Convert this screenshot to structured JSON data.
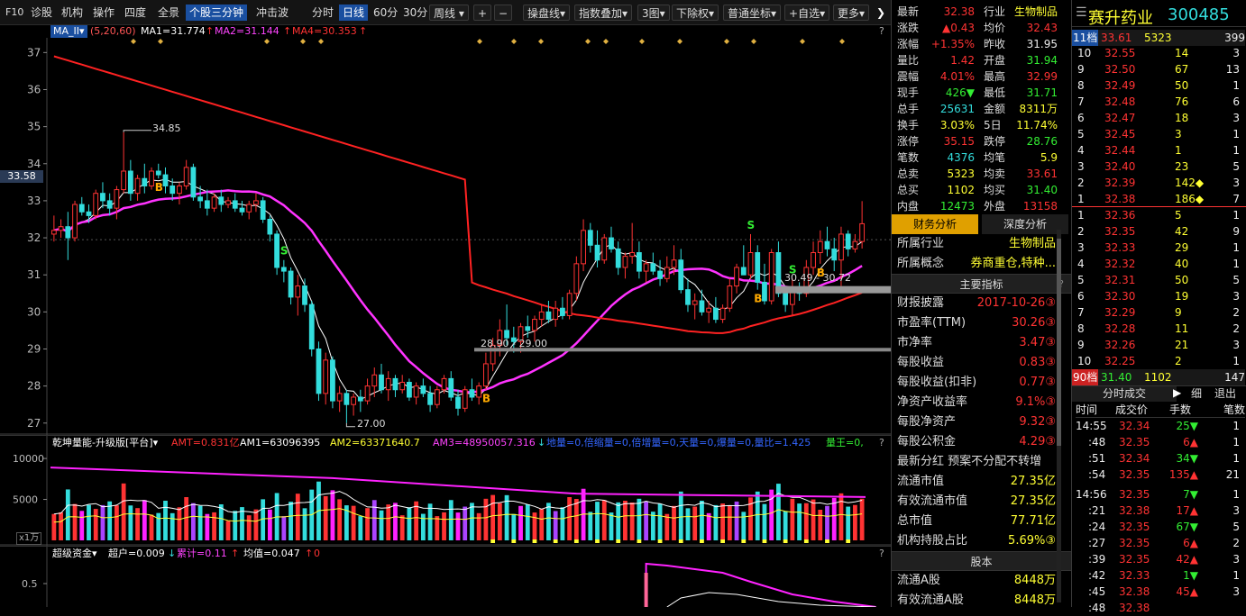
{
  "toolbar": {
    "items": [
      "F10",
      "诊股",
      "机构",
      "操作",
      "四度",
      "全景",
      "个股三分钟",
      "冲击波",
      "分时",
      "日线",
      "60分",
      "30分",
      "周线",
      "+",
      "−",
      "操盘线",
      "指数叠加",
      "3图",
      "下除权",
      "普通坐标",
      "自选",
      "更多"
    ],
    "active": [
      "个股三分钟",
      "日线"
    ]
  },
  "main_legend": {
    "name": "MA_II",
    "params": "(5,20,60)",
    "ma1": "MA1=31.774",
    "ma2": "MA2=31.144",
    "ma4": "MA4=30.353"
  },
  "price_tag": "33.58",
  "annotations": {
    "high": "34.85",
    "low": "27.00",
    "range1": "28.90 - 29.00",
    "range2": "30.49 - 30.72"
  },
  "vol_legend": {
    "name": "乾坤量能-升级版[平台]",
    "amt": "AMT=0.831亿",
    "am1": "AM1=63096395",
    "am2": "AM2=63371640.7",
    "am3": "AM3=48950057.316",
    "rest": "地量=0,倍缩量=0,倍增量=0,天量=0,爆量=0,量比=1.425",
    "wang": "量王=0,",
    "unit": "x1万"
  },
  "fund_legend": {
    "name": "超级资金",
    "chao": "超户=0.009",
    "lei": "累计=0.11",
    "jun": "均值=0.047",
    "tail": "0"
  },
  "axes": {
    "price": [
      "37",
      "36",
      "35",
      "34",
      "33",
      "32",
      "31",
      "30",
      "29",
      "28",
      "27"
    ],
    "volume": [
      "10000",
      "5000"
    ],
    "fund": [
      "0.5"
    ]
  },
  "stats": [
    [
      "最新",
      "32.38",
      "行业",
      "生物制品"
    ],
    [
      "涨跌",
      "▲0.43",
      "均价",
      "32.43"
    ],
    [
      "涨幅",
      "+1.35%",
      "昨收",
      "31.95"
    ],
    [
      "量比",
      "1.42",
      "开盘",
      "31.94"
    ],
    [
      "震幅",
      "4.01%",
      "最高",
      "32.99"
    ],
    [
      "现手",
      "426▼",
      "最低",
      "31.71"
    ],
    [
      "总手",
      "25631",
      "金额",
      "8311万"
    ],
    [
      "换手",
      "3.03%",
      "5日",
      "11.74%"
    ],
    [
      "涨停",
      "35.15",
      "跌停",
      "28.76"
    ],
    [
      "笔数",
      "4376",
      "均笔",
      "5.9"
    ],
    [
      "总卖",
      "5323",
      "均卖",
      "33.61"
    ],
    [
      "总买",
      "1102",
      "均买",
      "31.40"
    ],
    [
      "内盘",
      "12473",
      "外盘",
      "13158"
    ]
  ],
  "tabs": {
    "finance": "财务分析",
    "depth": "深度分析"
  },
  "industry": {
    "label": "所属行业",
    "value": "生物制品"
  },
  "concept": {
    "label": "所属概念",
    "value": "券商重仓,特种..."
  },
  "indicators_title": "主要指标",
  "fin": [
    [
      "财报披露",
      "2017-10-26③"
    ],
    [
      "市盈率(TTM)",
      "30.26③"
    ],
    [
      "市净率",
      "3.47③"
    ],
    [
      "每股收益",
      "0.83③"
    ],
    [
      "每股收益(扣非)",
      "0.77③"
    ],
    [
      "净资产收益率",
      "9.1%③"
    ],
    [
      "每股净资产",
      "9.32③"
    ],
    [
      "每股公积金",
      "4.29③"
    ]
  ],
  "dividend": "最新分红  预案不分配不转增",
  "fin2": [
    [
      "流通市值",
      "27.35亿"
    ],
    [
      "有效流通市值",
      "27.35亿"
    ],
    [
      "总市值",
      "77.71亿"
    ],
    [
      "机构持股占比",
      "5.69%③"
    ]
  ],
  "equity_title": "股本",
  "equity": [
    [
      "流通A股",
      "8448万"
    ],
    [
      "有效流通A股",
      "8448万"
    ]
  ],
  "stock": {
    "name": "赛升药业",
    "code": "300485"
  },
  "top_row": {
    "label": "11档",
    "price": "33.61",
    "vol": "5323",
    "count": "399"
  },
  "asks": [
    [
      "10",
      "32.55",
      "14",
      "3"
    ],
    [
      "9",
      "32.50",
      "67",
      "13"
    ],
    [
      "8",
      "32.49",
      "50",
      "1"
    ],
    [
      "7",
      "32.48",
      "76",
      "6"
    ],
    [
      "6",
      "32.47",
      "18",
      "3"
    ],
    [
      "5",
      "32.45",
      "3",
      "1"
    ],
    [
      "4",
      "32.44",
      "1",
      "1"
    ],
    [
      "3",
      "32.40",
      "23",
      "5"
    ],
    [
      "2",
      "32.39",
      "142◆",
      "3"
    ],
    [
      "1",
      "32.38",
      "186◆",
      "7"
    ]
  ],
  "bids": [
    [
      "1",
      "32.36",
      "5",
      "1"
    ],
    [
      "2",
      "32.35",
      "42",
      "9"
    ],
    [
      "3",
      "32.33",
      "29",
      "1"
    ],
    [
      "4",
      "32.32",
      "40",
      "1"
    ],
    [
      "5",
      "32.31",
      "50",
      "5"
    ],
    [
      "6",
      "32.30",
      "19",
      "3"
    ],
    [
      "7",
      "32.29",
      "9",
      "2"
    ],
    [
      "8",
      "32.28",
      "11",
      "2"
    ],
    [
      "9",
      "32.26",
      "21",
      "3"
    ],
    [
      "10",
      "32.25",
      "2",
      "1"
    ]
  ],
  "bottom_row": {
    "label": "90档",
    "price": "31.40",
    "vol": "1102",
    "count": "147"
  },
  "trades_tabs": {
    "main": "分时成交",
    "fine": "细",
    "exit": "退出"
  },
  "trades_header": [
    "时间",
    "成交价",
    "手数",
    "笔数"
  ],
  "trades": [
    [
      "14:55",
      "32.34",
      "25▼",
      "1"
    ],
    [
      ":48",
      "32.35",
      "6▲",
      "1"
    ],
    [
      ":51",
      "32.34",
      "34▼",
      "1"
    ],
    [
      ":54",
      "32.35",
      "135▲",
      "21"
    ],
    [
      "14:56",
      "32.35",
      "7▼",
      "1"
    ],
    [
      ":21",
      "32.38",
      "17▲",
      "3"
    ],
    [
      ":24",
      "32.35",
      "67▼",
      "5"
    ],
    [
      ":27",
      "32.35",
      "6▲",
      "2"
    ],
    [
      ":39",
      "32.35",
      "42▲",
      "3"
    ],
    [
      ":42",
      "32.33",
      "1▼",
      "1"
    ],
    [
      ":45",
      "32.38",
      "45▲",
      "3"
    ],
    [
      ":48",
      "32.38",
      "",
      ""
    ]
  ],
  "colors": {
    "up": "#ff3333",
    "down": "#33dddd",
    "ma1": "#ffffff",
    "ma2": "#ff33ff",
    "ma4": "#ff2222",
    "accent": "#1a4fa0"
  },
  "chart_data": {
    "type": "candlestick",
    "ohlc": [
      [
        32.1,
        32.6,
        31.9,
        32.2
      ],
      [
        32.2,
        32.5,
        32.0,
        32.3
      ],
      [
        32.3,
        32.7,
        31.4,
        32.0
      ],
      [
        32.0,
        33.0,
        31.9,
        32.9
      ],
      [
        32.9,
        33.1,
        32.6,
        32.7
      ],
      [
        32.7,
        32.9,
        32.4,
        32.6
      ],
      [
        32.6,
        33.3,
        32.5,
        33.2
      ],
      [
        33.2,
        33.5,
        32.8,
        33.0
      ],
      [
        33.0,
        33.2,
        32.6,
        32.8
      ],
      [
        32.8,
        33.4,
        32.5,
        33.3
      ],
      [
        33.3,
        34.85,
        33.2,
        33.8
      ],
      [
        33.8,
        34.1,
        33.0,
        33.2
      ],
      [
        33.2,
        33.7,
        33.0,
        33.6
      ],
      [
        33.6,
        34.0,
        33.2,
        33.4
      ],
      [
        33.4,
        33.9,
        33.3,
        33.8
      ],
      [
        33.8,
        34.0,
        33.6,
        33.7
      ],
      [
        33.7,
        33.9,
        33.2,
        33.4
      ],
      [
        33.4,
        33.6,
        33.0,
        33.2
      ],
      [
        33.2,
        33.5,
        32.9,
        33.4
      ],
      [
        33.4,
        34.1,
        33.3,
        33.9
      ],
      [
        33.9,
        34.0,
        33.0,
        33.1
      ],
      [
        33.1,
        33.4,
        32.8,
        33.0
      ],
      [
        33.0,
        33.3,
        32.6,
        32.8
      ],
      [
        32.8,
        33.2,
        32.7,
        33.1
      ],
      [
        33.1,
        33.3,
        32.7,
        32.9
      ],
      [
        32.9,
        33.1,
        32.8,
        33.0
      ],
      [
        33.0,
        33.2,
        32.7,
        32.8
      ],
      [
        32.8,
        33.0,
        32.6,
        32.7
      ],
      [
        32.7,
        33.0,
        32.5,
        32.9
      ],
      [
        32.9,
        33.2,
        32.7,
        33.0
      ],
      [
        33.0,
        33.1,
        32.4,
        32.5
      ],
      [
        32.5,
        32.6,
        31.9,
        32.1
      ],
      [
        32.1,
        32.2,
        31.0,
        31.2
      ],
      [
        31.2,
        31.4,
        30.8,
        31.1
      ],
      [
        31.1,
        31.2,
        30.2,
        30.4
      ],
      [
        30.4,
        31.0,
        29.9,
        30.7
      ],
      [
        30.7,
        30.9,
        30.0,
        30.2
      ],
      [
        30.2,
        30.3,
        28.8,
        29.0
      ],
      [
        29.0,
        29.2,
        27.6,
        27.8
      ],
      [
        27.8,
        28.9,
        27.5,
        28.7
      ],
      [
        28.7,
        28.8,
        27.4,
        27.6
      ],
      [
        27.6,
        28.0,
        27.3,
        27.8
      ],
      [
        27.8,
        27.9,
        27.0,
        27.5
      ],
      [
        27.5,
        27.8,
        27.2,
        27.7
      ],
      [
        27.7,
        27.9,
        27.3,
        27.6
      ],
      [
        27.6,
        28.2,
        27.5,
        28.0
      ],
      [
        28.0,
        28.5,
        27.7,
        28.3
      ],
      [
        28.3,
        28.6,
        27.8,
        27.9
      ],
      [
        27.9,
        28.4,
        27.6,
        28.2
      ],
      [
        28.2,
        28.3,
        27.7,
        27.9
      ],
      [
        27.9,
        28.3,
        27.8,
        28.1
      ],
      [
        28.1,
        28.2,
        27.6,
        27.7
      ],
      [
        27.7,
        28.1,
        27.5,
        28.0
      ],
      [
        28.0,
        28.2,
        27.7,
        27.8
      ],
      [
        27.8,
        28.0,
        27.3,
        27.5
      ],
      [
        27.5,
        28.0,
        27.4,
        27.9
      ],
      [
        27.9,
        28.3,
        27.8,
        28.2
      ],
      [
        28.2,
        28.4,
        27.6,
        27.7
      ],
      [
        27.7,
        27.9,
        27.2,
        27.4
      ],
      [
        27.4,
        28.0,
        27.3,
        27.9
      ],
      [
        27.9,
        28.2,
        27.6,
        27.7
      ],
      [
        27.7,
        28.1,
        27.5,
        28.0
      ],
      [
        28.0,
        28.9,
        27.9,
        28.6
      ],
      [
        28.6,
        29.3,
        28.4,
        29.1
      ],
      [
        29.1,
        29.8,
        28.8,
        29.5
      ],
      [
        29.5,
        30.2,
        29.1,
        29.3
      ],
      [
        29.3,
        29.6,
        28.9,
        29.2
      ],
      [
        29.2,
        29.7,
        28.9,
        29.6
      ],
      [
        29.6,
        29.9,
        29.3,
        29.5
      ],
      [
        29.5,
        29.9,
        29.2,
        29.8
      ],
      [
        29.8,
        30.2,
        29.6,
        30.0
      ],
      [
        30.0,
        30.3,
        29.7,
        29.8
      ],
      [
        29.8,
        30.3,
        29.6,
        30.1
      ],
      [
        30.1,
        30.4,
        29.8,
        29.9
      ],
      [
        29.9,
        30.6,
        29.8,
        30.5
      ],
      [
        30.5,
        31.5,
        30.3,
        31.3
      ],
      [
        31.3,
        32.5,
        31.1,
        32.2
      ],
      [
        32.2,
        32.4,
        31.6,
        31.8
      ],
      [
        31.8,
        32.2,
        31.2,
        31.4
      ],
      [
        31.4,
        32.1,
        31.3,
        32.0
      ],
      [
        32.0,
        32.3,
        31.6,
        31.7
      ],
      [
        31.7,
        31.9,
        31.0,
        31.2
      ],
      [
        31.2,
        31.6,
        30.9,
        31.5
      ],
      [
        31.5,
        32.4,
        31.3,
        31.6
      ],
      [
        31.6,
        31.9,
        30.9,
        31.1
      ],
      [
        31.1,
        31.4,
        30.8,
        31.3
      ],
      [
        31.3,
        31.6,
        31.0,
        31.1
      ],
      [
        31.1,
        31.4,
        30.7,
        30.9
      ],
      [
        30.9,
        31.5,
        30.8,
        31.2
      ],
      [
        31.2,
        31.8,
        31.0,
        31.4
      ],
      [
        31.4,
        31.7,
        30.5,
        30.6
      ],
      [
        30.6,
        30.9,
        30.0,
        30.2
      ],
      [
        30.2,
        30.5,
        29.8,
        30.3
      ],
      [
        30.3,
        30.6,
        29.9,
        30.0
      ],
      [
        30.0,
        30.3,
        29.7,
        30.1
      ],
      [
        30.1,
        30.4,
        29.7,
        29.8
      ],
      [
        29.8,
        30.2,
        29.7,
        30.1
      ],
      [
        30.1,
        30.9,
        30.0,
        30.7
      ],
      [
        30.7,
        31.3,
        30.5,
        31.2
      ],
      [
        31.2,
        31.8,
        31.0,
        31.0
      ],
      [
        31.0,
        32.1,
        30.9,
        31.6
      ],
      [
        31.6,
        31.8,
        30.6,
        30.8
      ],
      [
        30.8,
        31.3,
        30.2,
        30.3
      ],
      [
        30.3,
        31.7,
        30.2,
        31.6
      ],
      [
        31.6,
        31.9,
        30.4,
        30.5
      ],
      [
        30.5,
        30.7,
        30.0,
        30.2
      ],
      [
        30.2,
        30.9,
        29.9,
        30.6
      ],
      [
        30.6,
        30.8,
        30.3,
        30.5
      ],
      [
        30.5,
        31.4,
        30.4,
        31.2
      ],
      [
        31.2,
        31.9,
        31.0,
        31.6
      ],
      [
        31.6,
        32.2,
        31.3,
        31.9
      ],
      [
        31.9,
        32.3,
        31.5,
        31.7
      ],
      [
        31.7,
        32.0,
        31.1,
        31.4
      ],
      [
        31.4,
        32.3,
        30.7,
        32.1
      ],
      [
        32.1,
        32.2,
        31.5,
        31.7
      ],
      [
        31.7,
        32.1,
        31.6,
        31.9
      ],
      [
        31.9,
        32.99,
        31.71,
        32.38
      ]
    ],
    "ma_lines": [
      "MA1",
      "MA2",
      "MA4"
    ],
    "volume_unit": "x1万",
    "price_range": [
      26.8,
      37.3
    ]
  }
}
